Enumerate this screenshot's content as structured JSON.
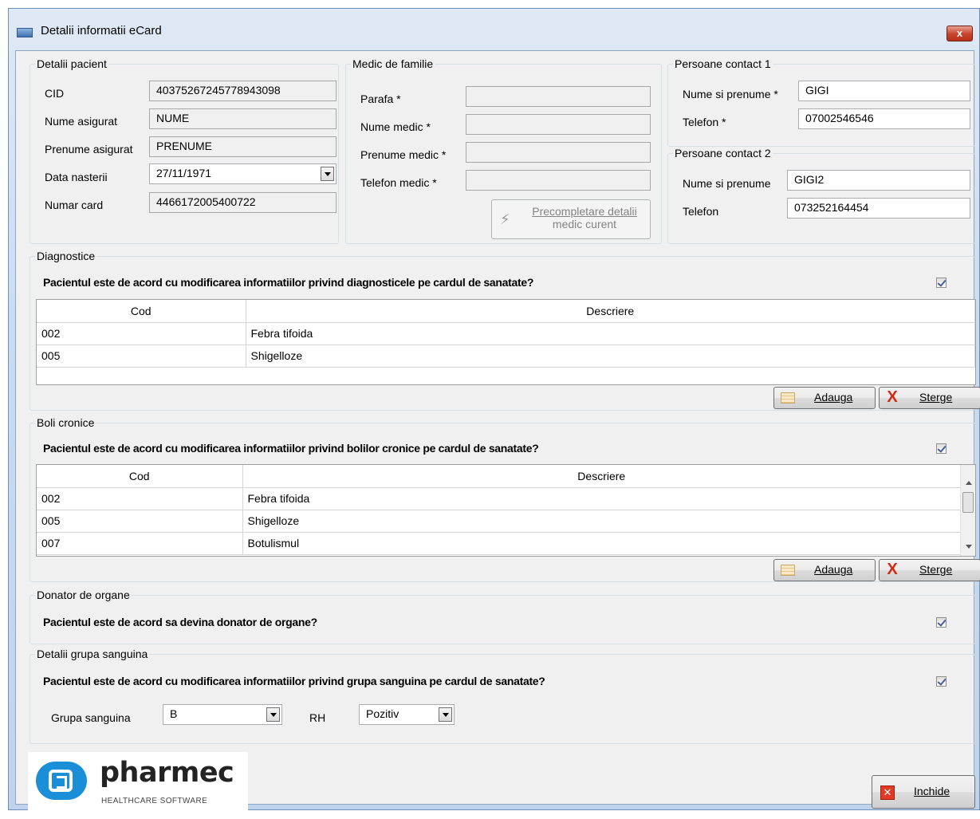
{
  "window": {
    "title": "Detalii informatii eCard",
    "close_glyph": "x"
  },
  "pacient": {
    "legend": "Detalii pacient",
    "cid_label": "CID",
    "cid": "40375267245778943098",
    "nume_label": "Nume asigurat",
    "nume": "NUME",
    "prenume_label": "Prenume asigurat",
    "prenume": "PRENUME",
    "data_label": "Data nasterii",
    "data": "27/11/1971",
    "card_label": "Numar card",
    "card": "4466172005400722"
  },
  "medic": {
    "legend": "Medic de familie",
    "parafa_label": "Parafa *",
    "nume_label": "Nume medic *",
    "prenume_label": "Prenume medic *",
    "telefon_label": "Telefon medic *",
    "precompletare_line1": "Precompletare detalii",
    "precompletare_line2": "medic curent"
  },
  "contact1": {
    "legend": "Persoane contact 1",
    "nume_label": "Nume si prenume *",
    "nume": "GIGI",
    "telefon_label": "Telefon *",
    "telefon": "07002546546"
  },
  "contact2": {
    "legend": "Persoane contact 2",
    "nume_label": "Nume si prenume",
    "nume": "GIGI2",
    "telefon_label": "Telefon",
    "telefon": "073252164454"
  },
  "diagnostice": {
    "legend": "Diagnostice",
    "question": "Pacientul este de acord cu modificarea informatiilor privind diagnosticele pe cardul de sanatate?",
    "checked": true,
    "columns": [
      "Cod",
      "Descriere"
    ],
    "rows": [
      [
        "002",
        "Febra tifoida"
      ],
      [
        "005",
        "Shigelloze"
      ]
    ],
    "add_label": "Adauga",
    "delete_label": "Sterge"
  },
  "boli": {
    "legend": "Boli cronice",
    "question": "Pacientul este de acord cu modificarea informatiilor privind bolilor cronice pe cardul de sanatate?",
    "checked": true,
    "columns": [
      "Cod",
      "Descriere"
    ],
    "rows": [
      [
        "002",
        "Febra tifoida"
      ],
      [
        "005",
        "Shigelloze"
      ],
      [
        "007",
        "Botulismul"
      ]
    ],
    "add_label": "Adauga",
    "delete_label": "Sterge"
  },
  "donator": {
    "legend": "Donator de organe",
    "question": "Pacientul este de acord sa devina donator de organe?",
    "checked": true
  },
  "grupa": {
    "legend": "Detalii grupa sanguina",
    "question": "Pacientul este de acord cu modificarea informatiilor privind grupa sanguina pe cardul de sanatate?",
    "checked": true,
    "grupa_label": "Grupa sanguina",
    "grupa_value": "B",
    "rh_label": "RH",
    "rh_value": "Pozitiv"
  },
  "logo": {
    "name": "pharmec",
    "tagline": "HEALTHCARE SOFTWARE"
  },
  "footer": {
    "close_label": "Inchide"
  }
}
